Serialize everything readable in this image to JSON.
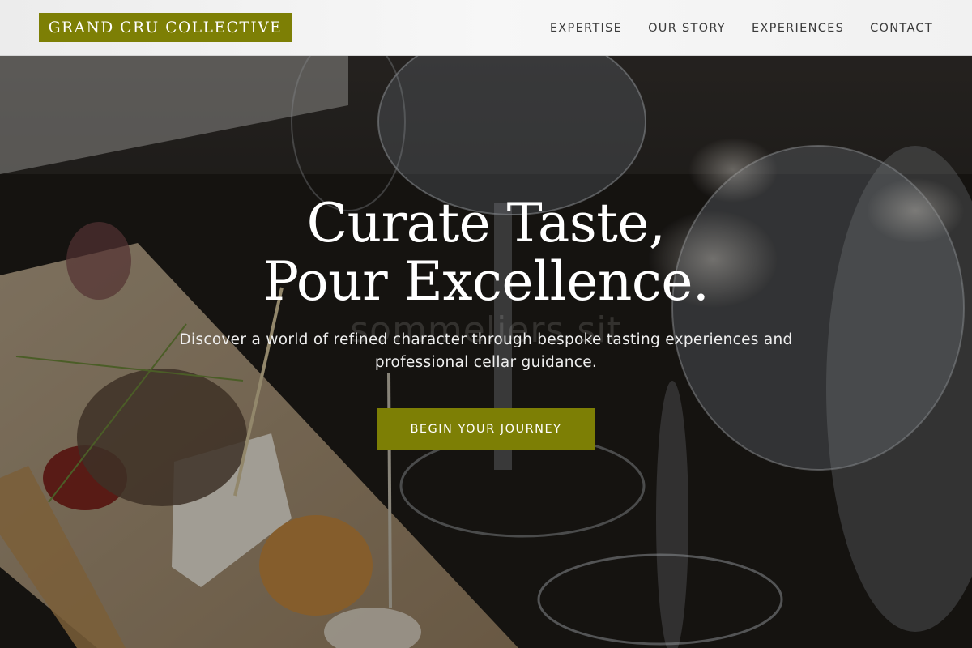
{
  "brand": {
    "name": "GRAND CRU COLLECTIVE",
    "accent_color": "#7d7f05"
  },
  "nav": {
    "items": [
      {
        "label": "EXPERTISE"
      },
      {
        "label": "OUR STORY"
      },
      {
        "label": "EXPERIENCES"
      },
      {
        "label": "CONTACT"
      }
    ]
  },
  "hero": {
    "headline_line1": "Curate Taste,",
    "headline_line2": "Pour Excellence.",
    "ghost_text": "sommeliers sit",
    "subtext": "Discover a world of refined character through bespoke tasting experiences and professional cellar guidance.",
    "cta_label": "BEGIN YOUR JOURNEY"
  }
}
